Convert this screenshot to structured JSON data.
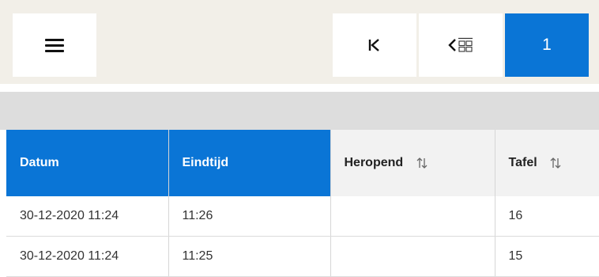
{
  "toolbar": {
    "menu_icon": "hamburger-menu-icon",
    "first_icon": "first-page-icon",
    "prev_icon": "previous-grid-icon",
    "page_number": "1"
  },
  "table": {
    "columns": [
      {
        "label": "Datum",
        "sortable": false,
        "active": true
      },
      {
        "label": "Eindtijd",
        "sortable": false,
        "active": true
      },
      {
        "label": "Heropend",
        "sortable": true,
        "active": false
      },
      {
        "label": "Tafel",
        "sortable": true,
        "active": false
      }
    ],
    "rows": [
      {
        "datum": "30-12-2020 11:24",
        "eindtijd": "11:26",
        "heropend": "",
        "tafel": "16"
      },
      {
        "datum": "30-12-2020 11:24",
        "eindtijd": "11:25",
        "heropend": "",
        "tafel": "15"
      }
    ]
  },
  "colors": {
    "accent": "#0a75d6",
    "topbar_bg": "#f2efe8",
    "filter_bar_bg": "#dddddd"
  }
}
